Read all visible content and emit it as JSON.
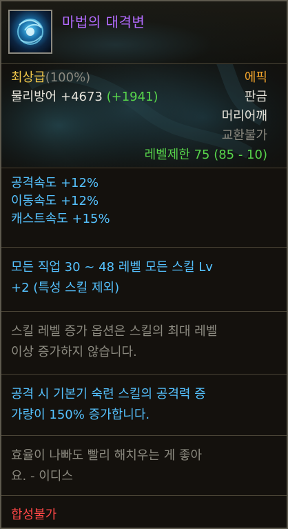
{
  "item": {
    "name": "마법의 대격변",
    "icon_name": "crystal-orb-icon",
    "grade": "최상급",
    "grade_percent": "(100%)",
    "stat_name": "물리방어",
    "stat_value": "+4673",
    "stat_bonus": "(+1941)",
    "rarity": "에픽",
    "type": "판금",
    "slot": "머리어깨",
    "trade": "교환불가",
    "level_req": "레벨제한 75 (85 - 10)"
  },
  "stats": [
    "공격속도 +12%",
    "이동속도 +12%",
    "캐스트속도 +15%"
  ],
  "skill_bonus": {
    "line1": "모든 직업 30 ~ 48 레벨 모든 스킬 Lv",
    "line2": "+2 (특성 스킬 제외)"
  },
  "skill_note": {
    "line1": "스킬 레벨 증가 옵션은 스킬의 최대 레벨",
    "line2": "이상 증가하지 않습니다."
  },
  "effect": {
    "line1": "공격 시 기본기 숙련 스킬의 공격력 증",
    "line2": "가량이 150% 증가합니다."
  },
  "flavor": {
    "line1": "효율이 나빠도 빨리 해치우는 게 좋아",
    "line2": "요. - 이디스"
  },
  "footer": {
    "fusion": "합성불가"
  },
  "colors": {
    "name": "#b36bff",
    "grade": "#f2c84b",
    "rarity": "#f4a52c",
    "level": "#58d64b",
    "skill": "#55c2ff",
    "footer": "#ff4747"
  }
}
